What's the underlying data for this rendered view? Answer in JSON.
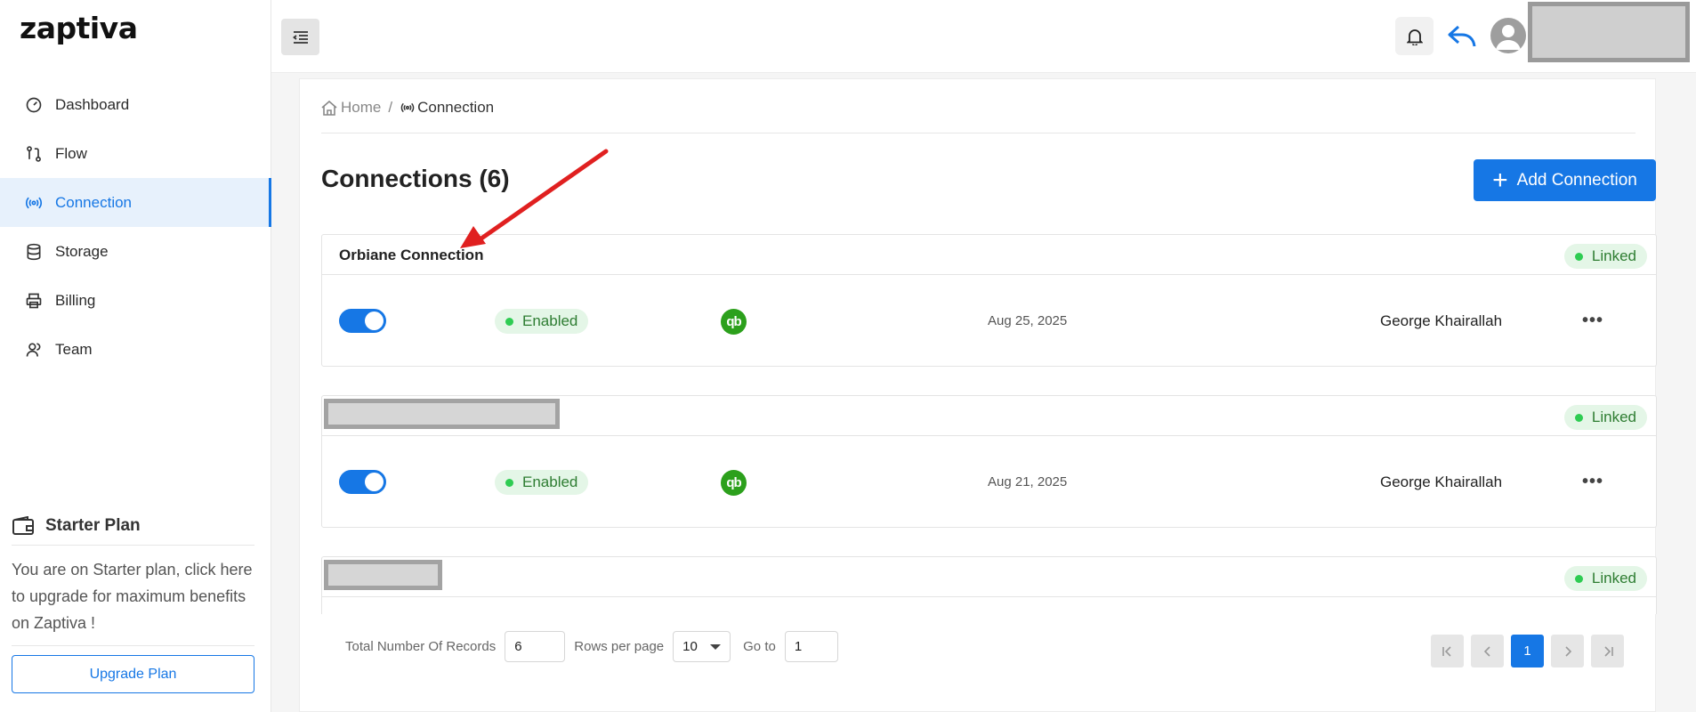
{
  "brand": {
    "logo_text": "zaptiva"
  },
  "sidebar": {
    "items": [
      {
        "label": "Dashboard",
        "icon": "gauge-icon",
        "active": false
      },
      {
        "label": "Flow",
        "icon": "flow-icon",
        "active": false
      },
      {
        "label": "Connection",
        "icon": "broadcast-icon",
        "active": true
      },
      {
        "label": "Storage",
        "icon": "database-icon",
        "active": false
      },
      {
        "label": "Billing",
        "icon": "printer-icon",
        "active": false
      },
      {
        "label": "Team",
        "icon": "team-icon",
        "active": false
      }
    ],
    "plan": {
      "title": "Starter Plan",
      "text": "You are on Starter plan, click here to upgrade for maximum benefits on Zaptiva !",
      "upgrade_label": "Upgrade Plan"
    }
  },
  "breadcrumb": {
    "home": "Home",
    "separator": "/",
    "current": "Connection"
  },
  "page": {
    "title": "Connections (6)",
    "add_label": "Add Connection"
  },
  "connections": [
    {
      "name": "Orbiane Connection",
      "name_redacted": false,
      "link_status": "Linked",
      "status": "Enabled",
      "provider_icon": "qb",
      "date": "Aug 25, 2025",
      "user": "George Khairallah"
    },
    {
      "name": "",
      "name_redacted": true,
      "link_status": "Linked",
      "status": "Enabled",
      "provider_icon": "qb",
      "date": "Aug 21, 2025",
      "user": "George Khairallah"
    },
    {
      "name": "",
      "name_redacted": true,
      "link_status": "Linked"
    }
  ],
  "pagination": {
    "total_label": "Total Number Of Records",
    "total_value": "6",
    "rows_label": "Rows per page",
    "rows_value": "10",
    "goto_label": "Go to",
    "goto_value": "1",
    "current_page": "1"
  },
  "colors": {
    "accent": "#1677e5",
    "success": "#2ecc52",
    "qb_green": "#2ca01c",
    "annotation": "#e02020"
  }
}
